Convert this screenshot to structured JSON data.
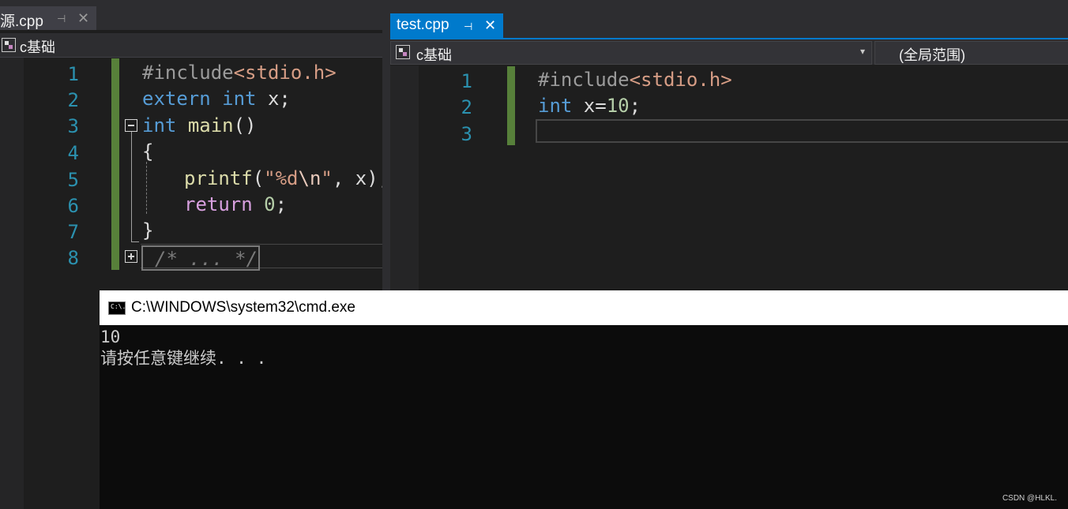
{
  "left_editor": {
    "tab_title": "源.cpp",
    "pin_glyph": "⊣",
    "close_glyph": "✕",
    "nav_scope": "c基础",
    "line_numbers": [
      "1",
      "2",
      "3",
      "4",
      "5",
      "6",
      "7",
      "8"
    ],
    "lines": {
      "l1": {
        "pp": "#include",
        "inc": "<stdio.h>"
      },
      "l2": {
        "kw": "extern",
        "kw2": "int",
        "rest": " x;"
      },
      "l3": {
        "kw": "int",
        "fn": "main",
        "rest": "()"
      },
      "l4": {
        "rest": "{"
      },
      "l5": {
        "fn": "printf",
        "p1": "(",
        "str1": "\"%d",
        "esc": "\\n",
        "str2": "\"",
        "rest": ", x);"
      },
      "l6": {
        "ctl": "return",
        "num": "0",
        "rest": ";"
      },
      "l7": {
        "rest": "}"
      },
      "l8": {
        "cm": "/* ... */"
      }
    }
  },
  "right_editor": {
    "tab_title": "test.cpp",
    "pin_glyph": "⊣",
    "close_glyph": "✕",
    "nav_scope": "c基础",
    "nav_dropdown_glyph": "▾",
    "nav_member": "(全局范围)",
    "line_numbers": [
      "1",
      "2",
      "3"
    ],
    "lines": {
      "l1": {
        "pp": "#include",
        "inc": "<stdio.h>"
      },
      "l2": {
        "kw": "int",
        "rest1": " x=",
        "num": "10",
        "rest2": ";"
      }
    }
  },
  "console": {
    "title": "C:\\WINDOWS\\system32\\cmd.exe",
    "icon_text": "C:\\.",
    "output_lines": [
      "10",
      "请按任意键继续. . ."
    ]
  },
  "watermark": "CSDN @HLKL."
}
